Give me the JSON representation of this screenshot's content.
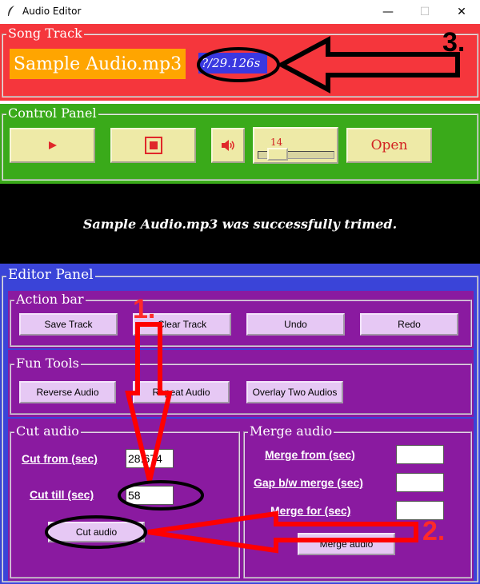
{
  "window": {
    "title": "Audio Editor",
    "minimize": "—",
    "maximize": "☐",
    "close": "✕"
  },
  "song_track": {
    "legend": "Song Track",
    "filename": "Sample Audio.mp3",
    "time": "?/29.126s"
  },
  "control_panel": {
    "legend": "Control Panel",
    "volume": "14",
    "open_label": "Open"
  },
  "status": {
    "message": "Sample Audio.mp3 was successfully trimed."
  },
  "editor": {
    "legend": "Editor Panel",
    "action_bar": {
      "legend": "Action bar",
      "save": "Save Track",
      "clear": "Clear Track",
      "undo": "Undo",
      "redo": "Redo"
    },
    "fun_tools": {
      "legend": "Fun Tools",
      "reverse": "Reverse Audio",
      "repeat": "Repeat Audio",
      "overlay": "Overlay Two Audios"
    },
    "cut_audio": {
      "legend": "Cut audio",
      "from_label": "Cut from (sec)",
      "from_value": "28.674",
      "till_label": "Cut till (sec)",
      "till_value": "58",
      "button": "Cut audio"
    },
    "merge_audio": {
      "legend": "Merge audio",
      "from_label": "Merge from (sec)",
      "gap_label": "Gap b/w merge (sec)",
      "for_label": "Merge for (sec)",
      "from_value": "",
      "gap_value": "",
      "for_value": "",
      "button": "Merge audio"
    }
  },
  "annotations": {
    "one": "1.",
    "two": "2.",
    "three": "3."
  },
  "colors": {
    "song_bg": "#f5363c",
    "control_bg": "#3aaa1a",
    "editor_bg": "#3a44d8",
    "panel_bg": "#8a1aa0",
    "button_bg": "#eeeaa7",
    "editor_button_bg": "#e6c8f4",
    "accent_orange": "#ffa500",
    "annotation_red": "#ff0000"
  }
}
